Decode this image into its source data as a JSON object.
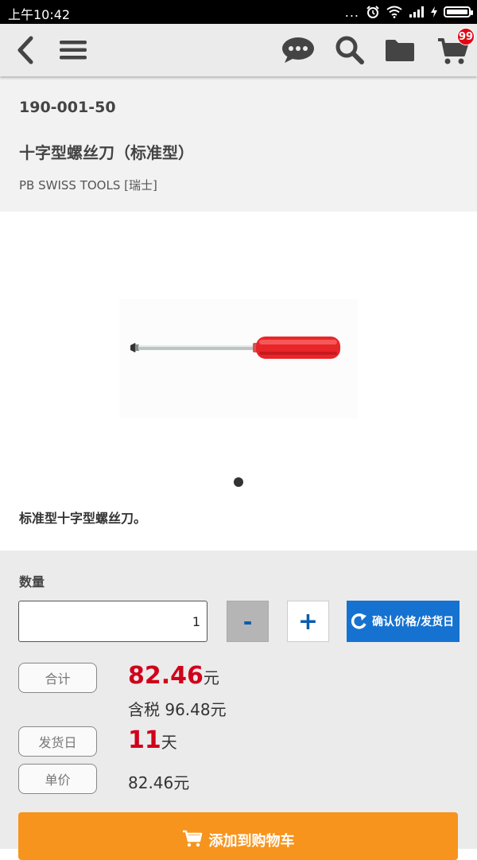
{
  "status_bar": {
    "time": "上午10:42",
    "dots": "...",
    "network": "4G"
  },
  "nav": {
    "cart_badge": "99"
  },
  "product": {
    "sku": "190-001-50",
    "name": "十字型螺丝刀（标准型）",
    "brand": "PB SWISS TOOLS [瑞士]",
    "description": "标准型十字型螺丝刀。"
  },
  "purchase": {
    "quantity_label": "数量",
    "quantity_value": "1",
    "minus_label": "-",
    "plus_label": "+",
    "confirm_label": "确认价格/发货日",
    "total_tag": "合计",
    "total_value": "82.46",
    "total_unit": "元",
    "tax_text": "含税 96.48元",
    "delivery_tag": "发货日",
    "delivery_value": "11",
    "delivery_unit": "天",
    "unit_price_tag": "单价",
    "unit_price_text": "82.46元",
    "add_to_cart_label": "添加到购物车"
  },
  "colors": {
    "accent_blue": "#1672d0",
    "price_red": "#d0021b",
    "cart_orange": "#f7941d",
    "badge_red": "#e30613"
  },
  "icons": [
    "back-icon",
    "menu-icon",
    "chat-icon",
    "search-icon",
    "folder-icon",
    "cart-icon",
    "refresh-icon"
  ]
}
